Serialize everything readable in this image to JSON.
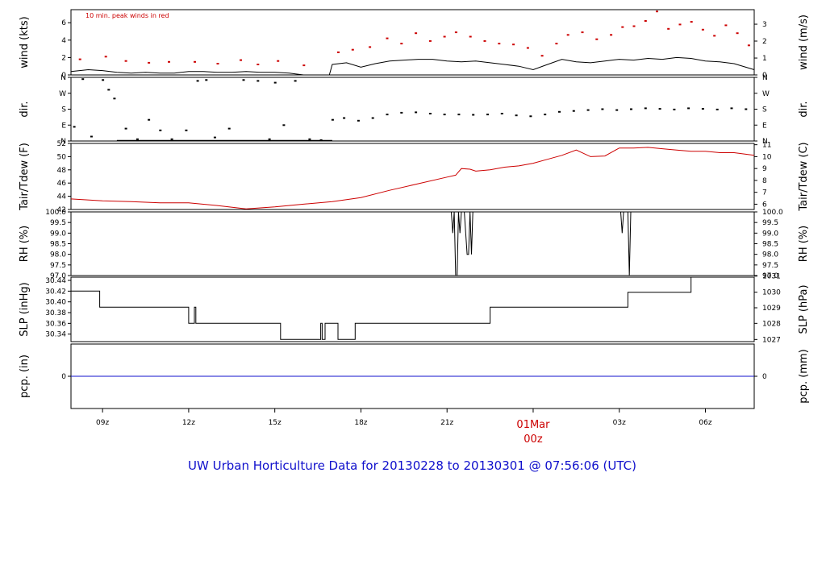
{
  "title": "UW Urban Horticulture Data for 20130228  to  20130301 @ 07:56:06  (UTC)",
  "colors": {
    "red": "#cc0000",
    "blue": "#1010cc",
    "black": "#000000"
  },
  "chart_data": {
    "type": "line",
    "x_axis": {
      "unit": "hour (UTC)",
      "start_hour": 7.9,
      "end_hour": 31.7,
      "ticks": [
        {
          "hour": 9,
          "label": "09z"
        },
        {
          "hour": 12,
          "label": "12z"
        },
        {
          "hour": 15,
          "label": "15z"
        },
        {
          "hour": 18,
          "label": "18z"
        },
        {
          "hour": 21,
          "label": "21z"
        },
        {
          "hour": 24,
          "label": "00z"
        },
        {
          "hour": 27,
          "label": "03z"
        },
        {
          "hour": 30,
          "label": "06z"
        }
      ],
      "day_label": {
        "hour": 24,
        "label": "01Mar"
      }
    },
    "panels": [
      {
        "id": "wind",
        "ylabel_left": "wind (kts)",
        "ylabel_right": "wind (m/s)",
        "ylim": [
          0,
          7.5
        ],
        "left_ticks": [
          0,
          2,
          4,
          6
        ],
        "right_ticks": [
          {
            "value": 0,
            "label": "0"
          },
          {
            "value": 1.94,
            "label": "1"
          },
          {
            "value": 3.89,
            "label": "2"
          },
          {
            "value": 5.83,
            "label": "3"
          }
        ],
        "annotation": "10 min. peak winds in red",
        "series": [
          {
            "kind": "line",
            "color": "#000000",
            "x": [
              7.9,
              8.5,
              9.0,
              9.5,
              10.0,
              10.5,
              11.0,
              11.5,
              12.0,
              12.5,
              13.0,
              13.5,
              14.0,
              14.5,
              15.0,
              15.5,
              16.0,
              16.5,
              16.9,
              17.0,
              17.5,
              18.0,
              18.5,
              19.0,
              19.5,
              20.0,
              20.5,
              21.0,
              21.5,
              22.0,
              22.5,
              23.0,
              23.5,
              24.0,
              24.5,
              25.0,
              25.5,
              26.0,
              26.5,
              27.0,
              27.5,
              28.0,
              28.5,
              29.0,
              29.5,
              30.0,
              30.5,
              31.0,
              31.7
            ],
            "y": [
              0.4,
              0.6,
              0.5,
              0.3,
              0.2,
              0.3,
              0.2,
              0.2,
              0.4,
              0.4,
              0.3,
              0.3,
              0.4,
              0.3,
              0.3,
              0.2,
              0.0,
              0.0,
              0.0,
              1.2,
              1.4,
              0.9,
              1.3,
              1.6,
              1.7,
              1.8,
              1.8,
              1.6,
              1.5,
              1.6,
              1.4,
              1.2,
              1.0,
              0.6,
              1.2,
              1.8,
              1.5,
              1.4,
              1.6,
              1.8,
              1.7,
              1.9,
              1.8,
              2.0,
              1.9,
              1.6,
              1.5,
              1.3,
              0.6
            ]
          },
          {
            "kind": "points",
            "color": "#cc0000",
            "x": [
              8.2,
              9.1,
              9.8,
              10.6,
              11.3,
              12.2,
              13.0,
              13.8,
              14.4,
              15.1,
              16.0,
              17.2,
              17.7,
              18.3,
              18.9,
              19.4,
              19.9,
              20.4,
              20.9,
              21.3,
              21.8,
              22.3,
              22.8,
              23.3,
              23.8,
              24.3,
              24.8,
              25.2,
              25.7,
              26.2,
              26.7,
              27.1,
              27.5,
              27.9,
              28.3,
              28.7,
              29.1,
              29.5,
              29.9,
              30.3,
              30.7,
              31.1,
              31.5
            ],
            "y": [
              1.8,
              2.1,
              1.6,
              1.4,
              1.5,
              1.5,
              1.3,
              1.7,
              1.2,
              1.6,
              1.1,
              2.6,
              2.9,
              3.2,
              4.2,
              3.6,
              4.8,
              3.9,
              4.4,
              4.9,
              4.4,
              3.9,
              3.6,
              3.5,
              3.1,
              2.2,
              3.6,
              4.6,
              4.9,
              4.1,
              4.6,
              5.5,
              5.6,
              6.2,
              7.3,
              5.3,
              5.8,
              6.1,
              5.2,
              4.5,
              5.7,
              4.8,
              3.4
            ]
          }
        ]
      },
      {
        "id": "dir",
        "ylabel_left": "dir.",
        "ylabel_right": "dir.",
        "ylim": [
          0,
          360
        ],
        "left_ticks": [
          {
            "value": 0,
            "label": "N"
          },
          {
            "value": 90,
            "label": "E"
          },
          {
            "value": 180,
            "label": "S"
          },
          {
            "value": 270,
            "label": "W"
          },
          {
            "value": 360,
            "label": "N"
          }
        ],
        "right_ticks": [
          {
            "value": 0,
            "label": "N"
          },
          {
            "value": 90,
            "label": "E"
          },
          {
            "value": 180,
            "label": "S"
          },
          {
            "value": 270,
            "label": "W"
          },
          {
            "value": 360,
            "label": "N"
          }
        ],
        "series": [
          {
            "kind": "points",
            "color": "#000000",
            "x": [
              8.0,
              8.3,
              8.6,
              9.0,
              9.2,
              9.4,
              9.8,
              10.2,
              10.6,
              11.0,
              11.4,
              11.9,
              12.3,
              12.6,
              12.9,
              13.4,
              13.9,
              14.4,
              14.8,
              15.0,
              15.3,
              15.7,
              16.2,
              16.6,
              17.0,
              17.4,
              17.9,
              18.4,
              18.9,
              19.4,
              19.9,
              20.4,
              20.9,
              21.4,
              21.9,
              22.4,
              22.9,
              23.4,
              23.9,
              24.4,
              24.9,
              25.4,
              25.9,
              26.4,
              26.9,
              27.4,
              27.9,
              28.4,
              28.9,
              29.4,
              29.9,
              30.4,
              30.9,
              31.4
            ],
            "y": [
              80,
              350,
              25,
              345,
              290,
              240,
              70,
              10,
              120,
              60,
              10,
              60,
              340,
              345,
              20,
              70,
              345,
              340,
              10,
              330,
              90,
              340,
              10,
              5,
              120,
              130,
              115,
              130,
              150,
              160,
              162,
              155,
              150,
              150,
              148,
              150,
              155,
              145,
              140,
              150,
              165,
              170,
              175,
              180,
              175,
              180,
              185,
              182,
              178,
              185,
              182,
              178,
              185,
              180
            ]
          },
          {
            "kind": "line",
            "color": "#000000",
            "x": [
              9.5,
              17.0
            ],
            "y": [
              3,
              3
            ]
          }
        ]
      },
      {
        "id": "temp",
        "ylabel_left": "Tair/Tdew (F)",
        "ylabel_right": "Tair/Tdew (C)",
        "ylim": [
          42,
          52
        ],
        "left_ticks": [
          42,
          44,
          46,
          48,
          50,
          52
        ],
        "right_ticks": [
          {
            "value": 42.8,
            "label": "6"
          },
          {
            "value": 44.6,
            "label": "7"
          },
          {
            "value": 46.4,
            "label": "8"
          },
          {
            "value": 48.2,
            "label": "9"
          },
          {
            "value": 50.0,
            "label": "10"
          },
          {
            "value": 51.8,
            "label": "11"
          }
        ],
        "series": [
          {
            "kind": "line",
            "color": "#cc0000",
            "x": [
              7.9,
              9.0,
              10.0,
              11.0,
              12.0,
              13.0,
              14.0,
              15.0,
              16.0,
              17.0,
              18.0,
              19.0,
              20.0,
              21.0,
              21.3,
              21.5,
              21.8,
              22.0,
              22.5,
              23.0,
              23.5,
              24.0,
              24.5,
              25.0,
              25.5,
              26.0,
              26.5,
              27.0,
              27.5,
              28.0,
              28.5,
              29.0,
              29.5,
              30.0,
              30.5,
              31.0,
              31.7
            ],
            "y": [
              43.6,
              43.3,
              43.2,
              43.0,
              43.0,
              42.6,
              42.1,
              42.4,
              42.8,
              43.2,
              43.8,
              44.9,
              45.9,
              46.9,
              47.2,
              48.2,
              48.1,
              47.8,
              48.0,
              48.4,
              48.6,
              49.0,
              49.6,
              50.2,
              51.0,
              50.0,
              50.1,
              51.3,
              51.3,
              51.4,
              51.2,
              51.0,
              50.8,
              50.8,
              50.6,
              50.6,
              50.2
            ]
          }
        ]
      },
      {
        "id": "rh",
        "ylabel_left": "RH (%)",
        "ylabel_right": "RH (%)",
        "ylim": [
          97.0,
          100.0
        ],
        "left_ticks": [
          {
            "value": 97.0,
            "label": "97.0"
          },
          {
            "value": 97.5,
            "label": "97.5"
          },
          {
            "value": 98.0,
            "label": "98.0"
          },
          {
            "value": 98.5,
            "label": "98.5"
          },
          {
            "value": 99.0,
            "label": "99.0"
          },
          {
            "value": 99.5,
            "label": "99.5"
          },
          {
            "value": 100.0,
            "label": "100.0"
          }
        ],
        "right_ticks": [
          {
            "value": 97.0,
            "label": "97.0"
          },
          {
            "value": 97.5,
            "label": "97.5"
          },
          {
            "value": 98.0,
            "label": "98.0"
          },
          {
            "value": 98.5,
            "label": "98.5"
          },
          {
            "value": 99.0,
            "label": "99.0"
          },
          {
            "value": 99.5,
            "label": "99.5"
          },
          {
            "value": 100.0,
            "label": "100.0"
          }
        ],
        "series": [
          {
            "kind": "line",
            "color": "#000000",
            "x": [
              7.9,
              21.15,
              21.2,
              21.25,
              21.3,
              21.35,
              21.4,
              21.45,
              21.5,
              21.55,
              21.6,
              21.7,
              21.75,
              21.8,
              21.85,
              21.9,
              21.95,
              22.0,
              27.05,
              27.1,
              27.15,
              27.3,
              27.35,
              27.4,
              27.45,
              31.7
            ],
            "y": [
              100.0,
              100.0,
              99.0,
              100.0,
              97.0,
              97.0,
              100.0,
              99.0,
              100.0,
              100.0,
              100.0,
              98.0,
              98.0,
              100.0,
              98.0,
              100.0,
              100.0,
              100.0,
              100.0,
              99.0,
              100.0,
              100.0,
              97.0,
              100.0,
              100.0,
              100.0
            ]
          }
        ]
      },
      {
        "id": "slp",
        "ylabel_left": "SLP (inHg)",
        "ylabel_right": "SLP (hPa)",
        "ylim": [
          30.326,
          30.446
        ],
        "left_ticks": [
          {
            "value": 30.34,
            "label": "30.34"
          },
          {
            "value": 30.36,
            "label": "30.36"
          },
          {
            "value": 30.38,
            "label": "30.38"
          },
          {
            "value": 30.4,
            "label": "30.40"
          },
          {
            "value": 30.42,
            "label": "30.42"
          },
          {
            "value": 30.44,
            "label": "30.44"
          }
        ],
        "right_ticks": [
          {
            "value": 30.33,
            "label": "1027"
          },
          {
            "value": 30.36,
            "label": "1028"
          },
          {
            "value": 30.389,
            "label": "1029"
          },
          {
            "value": 30.418,
            "label": "1030"
          },
          {
            "value": 30.448,
            "label": "1031"
          }
        ],
        "series": [
          {
            "kind": "step",
            "color": "#000000",
            "x": [
              7.9,
              8.9,
              12.0,
              12.1,
              12.2,
              12.25,
              12.35,
              15.2,
              16.6,
              16.65,
              16.75,
              16.8,
              17.2,
              17.3,
              17.8,
              22.5,
              27.3,
              29.5,
              31.7
            ],
            "y": [
              30.42,
              30.39,
              30.36,
              30.36,
              30.39,
              30.36,
              30.36,
              30.33,
              30.36,
              30.33,
              30.36,
              30.36,
              30.33,
              30.33,
              30.36,
              30.39,
              30.418,
              30.446,
              30.446
            ]
          }
        ]
      },
      {
        "id": "pcp",
        "ylabel_left": "pcp. (in)",
        "ylabel_right": "pcp. (mm)",
        "ylim": [
          -0.1,
          0.1
        ],
        "left_ticks": [
          {
            "value": 0,
            "label": "0"
          }
        ],
        "right_ticks": [
          {
            "value": 0,
            "label": "0"
          }
        ],
        "series": [
          {
            "kind": "line",
            "color": "#1010cc",
            "x": [
              7.9,
              31.7
            ],
            "y": [
              0,
              0
            ]
          }
        ]
      }
    ]
  }
}
